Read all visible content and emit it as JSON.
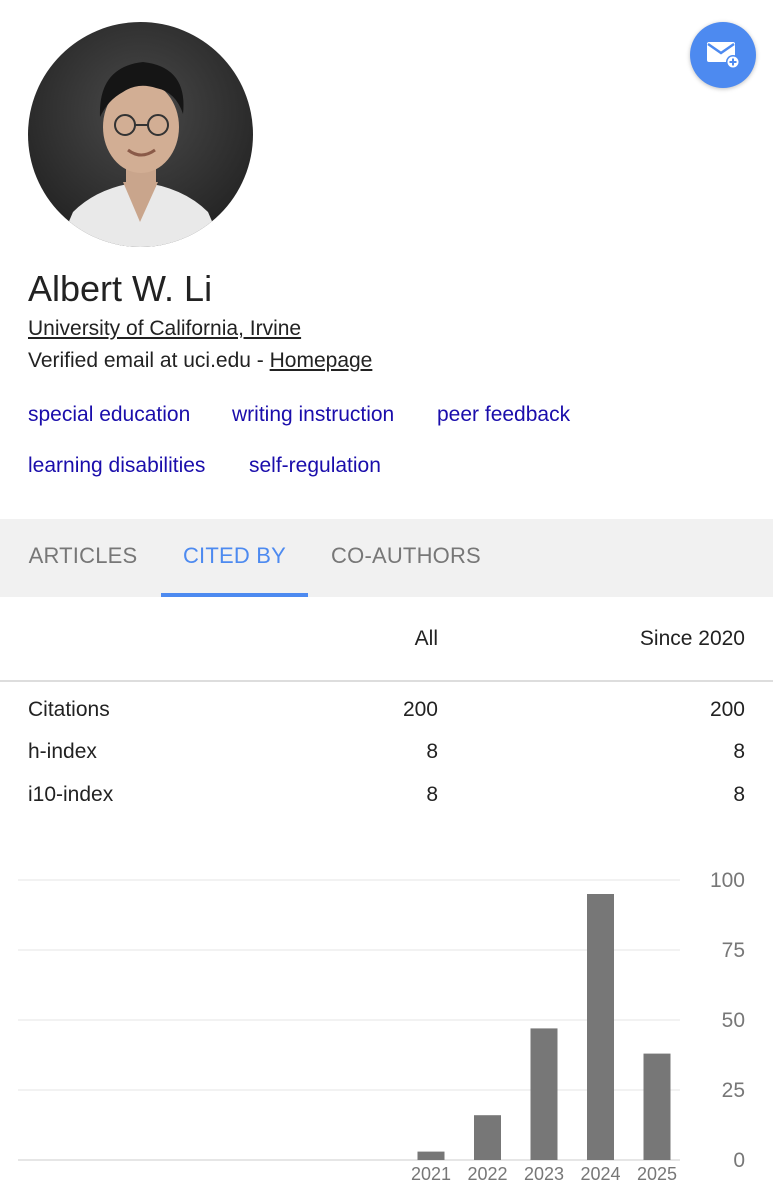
{
  "profile": {
    "name": "Albert W. Li",
    "affiliation": "University of California, Irvine",
    "email_prefix": "Verified email at uci.edu - ",
    "homepage_label": "Homepage",
    "interests": [
      "special education",
      "writing instruction",
      "peer feedback",
      "learning disabilities",
      "self-regulation"
    ]
  },
  "follow_button": {
    "icon": "email-add-icon",
    "color": "#4d8af0"
  },
  "tabs": [
    {
      "label": "ARTICLES",
      "active": false
    },
    {
      "label": "CITED BY",
      "active": true
    },
    {
      "label": "CO-AUTHORS",
      "active": false
    }
  ],
  "stats": {
    "columns": [
      "All",
      "Since 2020"
    ],
    "rows": [
      {
        "label": "Citations",
        "all": "200",
        "since": "200"
      },
      {
        "label": "h-index",
        "all": "8",
        "since": "8"
      },
      {
        "label": "i10-index",
        "all": "8",
        "since": "8"
      }
    ]
  },
  "chart_data": {
    "type": "bar",
    "categories": [
      "2021",
      "2022",
      "2023",
      "2024",
      "2025"
    ],
    "values": [
      3,
      16,
      47,
      95,
      38
    ],
    "ylim": [
      0,
      100
    ],
    "yticks": [
      "0",
      "25",
      "50",
      "75",
      "100"
    ],
    "grid": true,
    "bar_color": "#777777"
  }
}
